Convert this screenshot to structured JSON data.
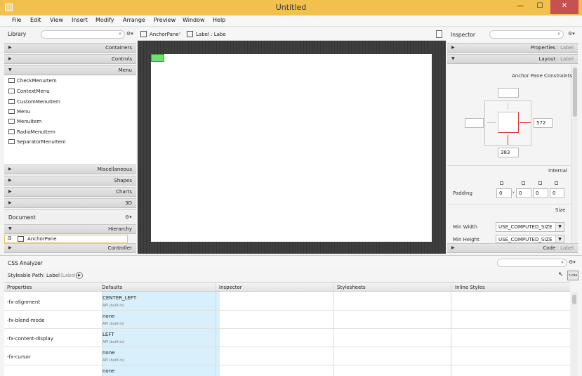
{
  "window": {
    "title": "Untitled",
    "min": "—",
    "max": "☐",
    "close": "✕"
  },
  "menu": [
    "File",
    "Edit",
    "View",
    "Insert",
    "Modify",
    "Arrange",
    "Preview",
    "Window",
    "Help"
  ],
  "library": {
    "label": "Library",
    "sections_top": [
      "Containers",
      "Controls",
      "Menu"
    ],
    "items": [
      "CheckMenuItem",
      "ContextMenu",
      "CustomMenuItem",
      "Menu",
      "MenuItem",
      "RadioMenuItem",
      "SeparatorMenuItem"
    ],
    "sections_bottom": [
      "Miscellaneous",
      "Shapes",
      "Charts",
      "3D"
    ]
  },
  "document": {
    "label": "Document",
    "hierarchy": "Hierarchy",
    "item": "AnchorPane",
    "controller": "Controller"
  },
  "breadcrumb": {
    "pane": "AnchorPane",
    "label": "Label : Labe"
  },
  "inspector": {
    "label": "Inspector",
    "properties": "Properties",
    "properties_suffix": ": Label",
    "layout": "Layout",
    "layout_suffix": ": Label",
    "constraints_title": "Anchor Pane Constraints",
    "right_value": "572",
    "bottom_value": "383",
    "internal": "Internal",
    "padding_label": "Padding",
    "padding_values": [
      "0",
      "0",
      "0",
      "0"
    ],
    "size_label": "Size",
    "min_width_label": "Min Width",
    "min_width_value": "USE_COMPUTED_SIZE",
    "min_height_label": "Min Height",
    "min_height_value": "USE_COMPUTED_SIZE",
    "code": "Code",
    "code_suffix": ": Label"
  },
  "css": {
    "title": "CSS Analyzer",
    "path_label": "Styleable Path:",
    "path_value": "Label",
    "path_type": "(Label)",
    "columns": [
      "Properties",
      "Defaults",
      "Inspector",
      "Stylesheets",
      "Inline Styles"
    ],
    "rows": [
      {
        "prop": "-fx-alignment",
        "default": "CENTER_LEFT",
        "src": "API (built-in)"
      },
      {
        "prop": "-fx-blend-mode",
        "default": "none",
        "src": "API (built-in)"
      },
      {
        "prop": "-fx-content-display",
        "default": "LEFT",
        "src": "API (built-in)"
      },
      {
        "prop": "-fx-cursor",
        "default": "none",
        "src": "API (built-in)"
      },
      {
        "prop": "",
        "default": "none",
        "src": ""
      }
    ]
  }
}
